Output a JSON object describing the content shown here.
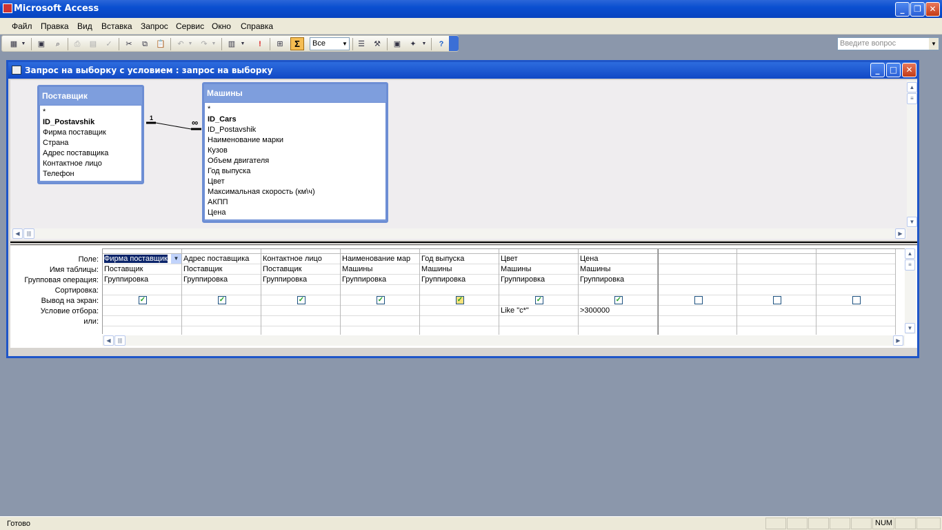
{
  "app": {
    "title": "Microsoft Access"
  },
  "menu": [
    "Файл",
    "Правка",
    "Вид",
    "Вставка",
    "Запрос",
    "Сервис",
    "Окно",
    "Справка"
  ],
  "ask_placeholder": "Введите вопрос",
  "toolbar": {
    "sigma": "Σ",
    "view_select": "Все"
  },
  "query_window": {
    "title": "Запрос на выборку с условием : запрос на выборку"
  },
  "tables": [
    {
      "name": "Поставщик",
      "fields": [
        "*",
        "ID_Postavshik",
        "Фирма поставщик",
        "Страна",
        "Адрес поставщика",
        "Контактное лицо",
        "Телефон"
      ]
    },
    {
      "name": "Машины",
      "fields": [
        "*",
        "ID_Cars",
        "ID_Postavshik",
        "Наименование марки",
        "Кузов",
        "Объем двигателя",
        "Год выпуска",
        "Цвет",
        "Максимальная скорость (км\\ч)",
        "АКПП",
        "Цена"
      ]
    }
  ],
  "relation": {
    "one": "1",
    "many": "∞"
  },
  "row_labels": [
    "Поле:",
    "Имя таблицы:",
    "Групповая операция:",
    "Сортировка:",
    "Вывод на экран:",
    "Условие отбора:",
    "или:"
  ],
  "columns": [
    {
      "field": "Фирма поставщик",
      "table": "Поставщик",
      "group": "Группировка",
      "sort": "",
      "show": true,
      "criteria": "",
      "or": ""
    },
    {
      "field": "Адрес поставщика",
      "table": "Поставщик",
      "group": "Группировка",
      "sort": "",
      "show": true,
      "criteria": "",
      "or": ""
    },
    {
      "field": "Контактное лицо",
      "table": "Поставщик",
      "group": "Группировка",
      "sort": "",
      "show": true,
      "criteria": "",
      "or": ""
    },
    {
      "field": "Наименование мар",
      "table": "Машины",
      "group": "Группировка",
      "sort": "",
      "show": true,
      "criteria": "",
      "or": ""
    },
    {
      "field": "Год выпуска",
      "table": "Машины",
      "group": "Группировка",
      "sort": "",
      "show": true,
      "criteria": "",
      "or": ""
    },
    {
      "field": "Цвет",
      "table": "Машины",
      "group": "Группировка",
      "sort": "",
      "show": true,
      "criteria": "Like \"c*\"",
      "or": ""
    },
    {
      "field": "Цена",
      "table": "Машины",
      "group": "Группировка",
      "sort": "",
      "show": true,
      "criteria": ">300000",
      "or": ""
    },
    {
      "field": "",
      "table": "",
      "group": "",
      "sort": "",
      "show": false,
      "criteria": "",
      "or": ""
    },
    {
      "field": "",
      "table": "",
      "group": "",
      "sort": "",
      "show": false,
      "criteria": "",
      "or": ""
    },
    {
      "field": "",
      "table": "",
      "group": "",
      "sort": "",
      "show": false,
      "criteria": "",
      "or": ""
    }
  ],
  "status": {
    "text": "Готово",
    "num": "NUM"
  }
}
